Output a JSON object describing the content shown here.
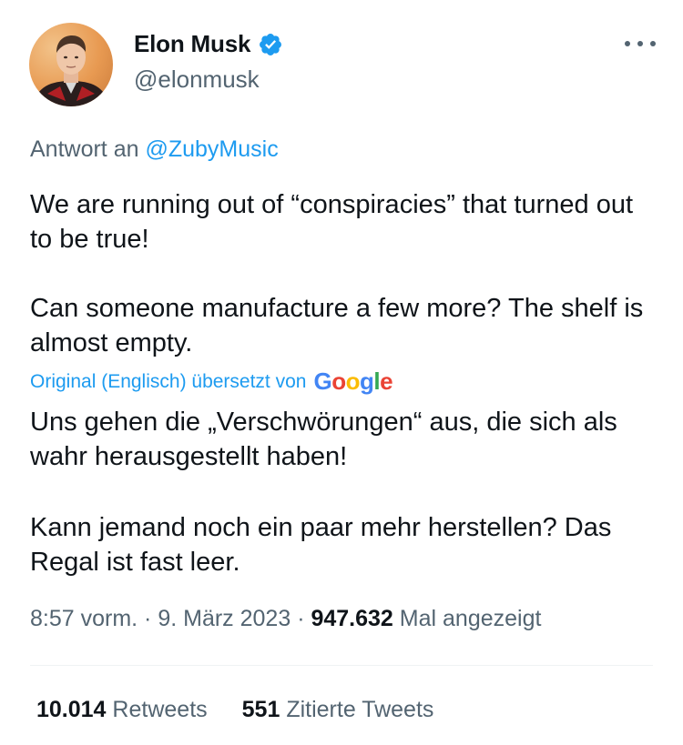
{
  "author": {
    "display_name": "Elon Musk",
    "handle": "@elonmusk",
    "verified": true,
    "verified_color": "#1d9bf0",
    "avatar_icon": "profile-photo"
  },
  "more_icon": "more-horizontal-icon",
  "reply": {
    "prefix": "Antwort an",
    "mention": "@ZubyMusic"
  },
  "tweet": {
    "paragraph_1": "We are running out of “conspiracies” that turned out to be true!",
    "paragraph_2": "Can someone manufacture a few more? The shelf is almost empty."
  },
  "translation": {
    "note": "Original (Englisch) übersetzt von",
    "provider": "Google",
    "paragraph_1": "Uns gehen die „Verschwörungen“ aus, die sich als wahr herausgestellt haben!",
    "paragraph_2": "Kann jemand noch ein paar mehr herstellen? Das Regal ist fast leer."
  },
  "meta": {
    "time": "8:57 vorm.",
    "separator": " · ",
    "date": "9. März 2023",
    "views_count": "947.632",
    "views_label": "Mal angezeigt"
  },
  "stats": {
    "retweets_count": "10.014",
    "retweets_label": "Retweets",
    "quotes_count": "551",
    "quotes_label": "Zitierte Tweets"
  },
  "colors": {
    "accent": "#1d9bf0",
    "text": "#0f1419",
    "secondary": "#536471",
    "divider": "#eff3f4"
  }
}
